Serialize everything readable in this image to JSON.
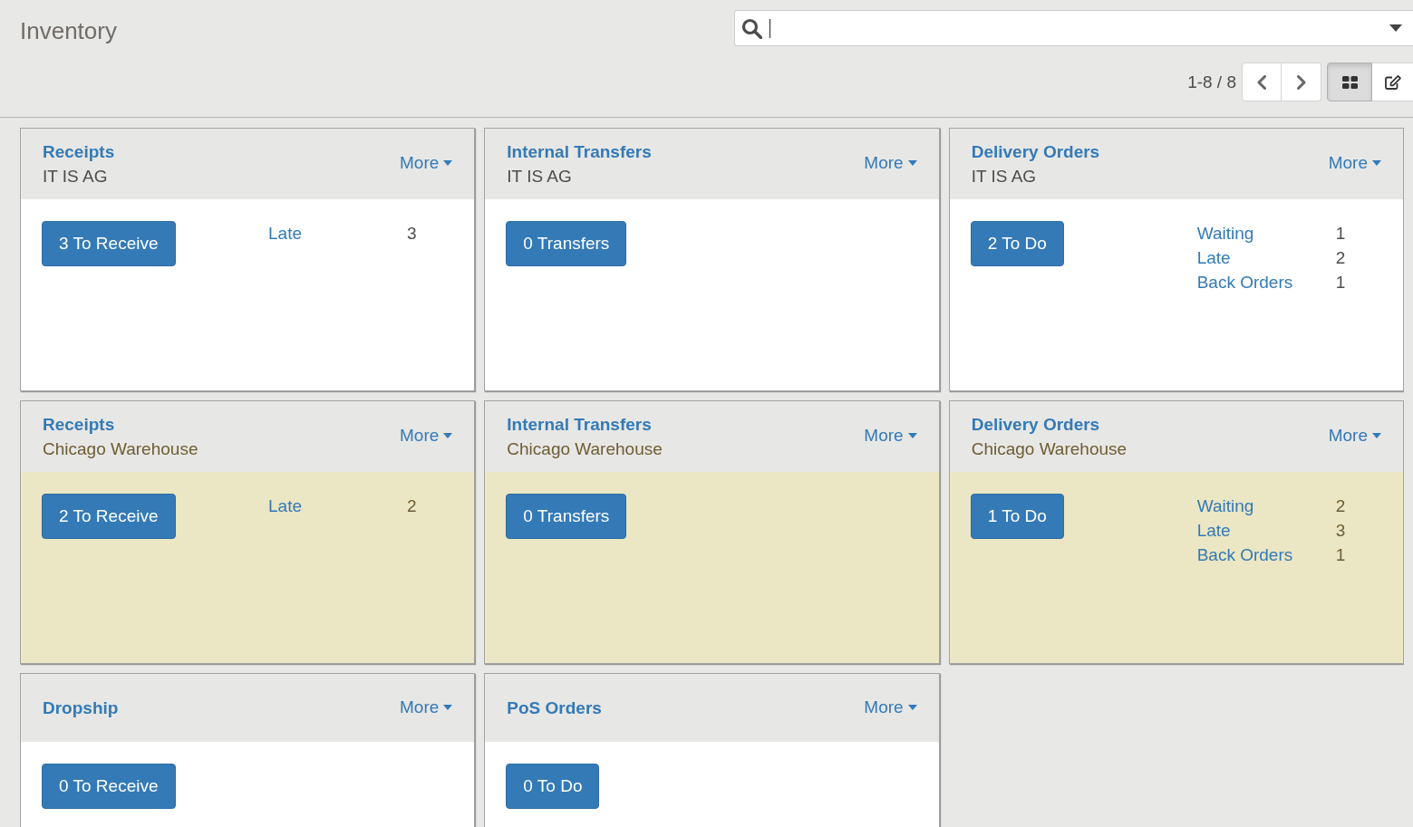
{
  "breadcrumb": {
    "title": "Inventory"
  },
  "search": {
    "focused": true
  },
  "pager": {
    "range": "1-8 / 8"
  },
  "views": [
    {
      "kind": "kanban",
      "selected": true
    },
    {
      "kind": "form",
      "selected": false
    }
  ],
  "cards": [
    {
      "title": "Receipts",
      "subtitle": "IT IS AG",
      "more": "More",
      "color": "#ffffff",
      "action": "3 To Receive",
      "stats": [
        {
          "label": "Late",
          "count": "3"
        }
      ]
    },
    {
      "title": "Internal Transfers",
      "subtitle": "IT IS AG",
      "more": "More",
      "color": "#ffffff",
      "action": "0 Transfers"
    },
    {
      "title": "Delivery Orders",
      "subtitle": "IT IS AG",
      "more": "More",
      "color": "#ffffff",
      "action": "2 To Do",
      "stats": [
        {
          "label": "Waiting",
          "count": "1"
        },
        {
          "label": "Late",
          "count": "2"
        },
        {
          "label": "Back Orders",
          "count": "1"
        }
      ]
    },
    {
      "title": "Receipts",
      "subtitle": "Chicago Warehouse",
      "more": "More",
      "color": "#ebe6c3",
      "action": "2 To Receive",
      "stats": [
        {
          "label": "Late",
          "count": "2"
        }
      ]
    },
    {
      "title": "Internal Transfers",
      "subtitle": "Chicago Warehouse",
      "more": "More",
      "color": "#ebe6c3",
      "action": "0 Transfers"
    },
    {
      "title": "Delivery Orders",
      "subtitle": "Chicago Warehouse",
      "more": "More",
      "color": "#ebe6c3",
      "action": "1 To Do",
      "stats": [
        {
          "label": "Waiting",
          "count": "2"
        },
        {
          "label": "Late",
          "count": "3"
        },
        {
          "label": "Back Orders",
          "count": "1"
        }
      ]
    },
    {
      "title": "Dropship",
      "more": "More",
      "color": "#ffffff",
      "action": "0 To Receive"
    },
    {
      "title": "PoS Orders",
      "more": "More",
      "color": "#ffffff",
      "action": "0 To Do"
    }
  ]
}
